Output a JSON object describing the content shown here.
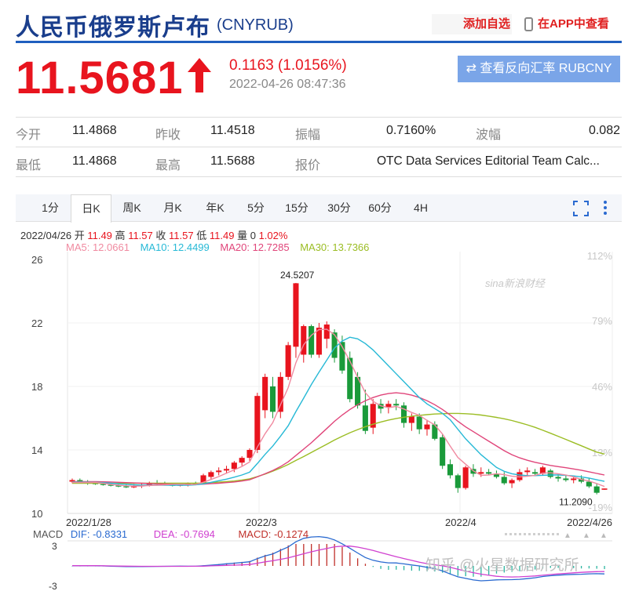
{
  "header": {
    "title": "人民币俄罗斯卢布",
    "code": "(CNYRUB)",
    "watchlist_label": "添加自选",
    "app_label": "在APP中查看",
    "app_icon": "phone-icon"
  },
  "quote": {
    "price": "11.5681",
    "change": "0.1163 (1.0156%)",
    "timestamp": "2022-04-26 08:47:36",
    "reverse_label": "查看反向汇率 RUBCNY",
    "reverse_icon": "swap-icon",
    "up_color": "#e8141e"
  },
  "stats": [
    {
      "label": "今开",
      "value": "11.4868"
    },
    {
      "label": "昨收",
      "value": "11.4518"
    },
    {
      "label": "振幅",
      "value": "0.7160%"
    },
    {
      "label": "波幅",
      "value": "0.082"
    },
    {
      "label": "最低",
      "value": "11.4868"
    },
    {
      "label": "最高",
      "value": "11.5688"
    },
    {
      "label": "报价",
      "value": "OTC Data Services Editorial Team Calc..."
    }
  ],
  "chart_tabs": [
    "1分",
    "日K",
    "周K",
    "月K",
    "年K",
    "5分",
    "15分",
    "30分",
    "60分",
    "4H"
  ],
  "active_tab": "日K",
  "ohlc_line": {
    "date": "2022/04/26",
    "open_label": "开",
    "open": "11.49",
    "high_label": "高",
    "high": "11.57",
    "close_label": "收",
    "close": "11.57",
    "low_label": "低",
    "low": "11.49",
    "vol_label": "量",
    "vol": "0",
    "pct": "1.02%"
  },
  "ma_line": {
    "ma5": "MA5: 12.0661",
    "ma10": "MA10: 12.4499",
    "ma20": "MA20: 12.7285",
    "ma30": "MA30: 13.7366"
  },
  "macd_line": {
    "label": "MACD",
    "dif": "DIF: -0.8331",
    "dea": "DEA: -0.7694",
    "macd": "MACD: -0.1274"
  },
  "watermarks": {
    "sina": "sina新浪财经",
    "zhihu": "知乎 @火星数据研究所"
  },
  "chart_data": {
    "type": "candlestick",
    "y_ticks": [
      "26",
      "22",
      "18",
      "14",
      "10"
    ],
    "pct_ticks": [
      "112%",
      "79%",
      "46%",
      "13%",
      "-19%"
    ],
    "x_ticks": [
      "2022/1/28",
      "2022/3",
      "2022/4",
      "2022/4/26"
    ],
    "high_mark": "24.5207",
    "low_mark": "11.2090",
    "ylim": [
      10,
      26
    ],
    "macd_ticks": [
      "3",
      "-3"
    ],
    "series_colors": {
      "ma5": "#f08aa0",
      "ma10": "#27b9d6",
      "ma20": "#e0457a",
      "ma30": "#9bbd24",
      "up": "#e8141e",
      "down": "#1a9a3a"
    },
    "candles": [
      {
        "o": 12.0,
        "h": 12.2,
        "l": 11.9,
        "c": 12.1
      },
      {
        "o": 12.1,
        "h": 12.2,
        "l": 11.9,
        "c": 11.95
      },
      {
        "o": 11.95,
        "h": 12.1,
        "l": 11.8,
        "c": 11.9
      },
      {
        "o": 11.9,
        "h": 12.0,
        "l": 11.8,
        "c": 11.85
      },
      {
        "o": 11.85,
        "h": 11.95,
        "l": 11.75,
        "c": 11.8
      },
      {
        "o": 11.8,
        "h": 11.9,
        "l": 11.7,
        "c": 11.75
      },
      {
        "o": 11.75,
        "h": 11.9,
        "l": 11.65,
        "c": 11.7
      },
      {
        "o": 11.7,
        "h": 11.85,
        "l": 11.6,
        "c": 11.65
      },
      {
        "o": 11.65,
        "h": 11.85,
        "l": 11.6,
        "c": 11.7
      },
      {
        "o": 11.7,
        "h": 11.9,
        "l": 11.6,
        "c": 11.8
      },
      {
        "o": 11.8,
        "h": 12.0,
        "l": 11.7,
        "c": 11.9
      },
      {
        "o": 11.9,
        "h": 12.1,
        "l": 11.8,
        "c": 11.85
      },
      {
        "o": 11.85,
        "h": 12.0,
        "l": 11.75,
        "c": 11.8
      },
      {
        "o": 11.8,
        "h": 11.9,
        "l": 11.7,
        "c": 11.75
      },
      {
        "o": 11.75,
        "h": 11.9,
        "l": 11.7,
        "c": 11.8
      },
      {
        "o": 11.8,
        "h": 11.95,
        "l": 11.7,
        "c": 11.9
      },
      {
        "o": 11.9,
        "h": 12.0,
        "l": 11.8,
        "c": 11.85
      },
      {
        "o": 11.9,
        "h": 12.5,
        "l": 11.85,
        "c": 12.4
      },
      {
        "o": 12.3,
        "h": 12.7,
        "l": 12.1,
        "c": 12.6
      },
      {
        "o": 12.6,
        "h": 12.9,
        "l": 12.4,
        "c": 12.7
      },
      {
        "o": 12.7,
        "h": 13.0,
        "l": 12.5,
        "c": 12.8
      },
      {
        "o": 12.8,
        "h": 13.3,
        "l": 12.6,
        "c": 13.2
      },
      {
        "o": 13.2,
        "h": 13.6,
        "l": 13.0,
        "c": 13.5
      },
      {
        "o": 13.5,
        "h": 14.1,
        "l": 13.3,
        "c": 14.0
      },
      {
        "o": 14.0,
        "h": 17.6,
        "l": 13.8,
        "c": 17.4
      },
      {
        "o": 16.5,
        "h": 18.8,
        "l": 16.0,
        "c": 18.6
      },
      {
        "o": 18.0,
        "h": 18.6,
        "l": 16.0,
        "c": 16.4
      },
      {
        "o": 16.4,
        "h": 18.9,
        "l": 16.0,
        "c": 18.6
      },
      {
        "o": 18.6,
        "h": 20.8,
        "l": 18.4,
        "c": 20.6
      },
      {
        "o": 20.5,
        "h": 24.52,
        "l": 19.8,
        "c": 24.5
      },
      {
        "o": 20.0,
        "h": 21.9,
        "l": 19.5,
        "c": 21.8
      },
      {
        "o": 21.8,
        "h": 21.9,
        "l": 19.8,
        "c": 20.0
      },
      {
        "o": 20.0,
        "h": 22.0,
        "l": 19.8,
        "c": 21.7
      },
      {
        "o": 21.0,
        "h": 22.1,
        "l": 20.4,
        "c": 21.9
      },
      {
        "o": 21.4,
        "h": 21.6,
        "l": 19.5,
        "c": 19.8
      },
      {
        "o": 20.8,
        "h": 21.2,
        "l": 18.8,
        "c": 19.0
      },
      {
        "o": 19.8,
        "h": 20.2,
        "l": 17.0,
        "c": 17.2
      },
      {
        "o": 18.6,
        "h": 18.9,
        "l": 16.6,
        "c": 16.8
      },
      {
        "o": 16.8,
        "h": 17.8,
        "l": 15.0,
        "c": 15.2
      },
      {
        "o": 15.4,
        "h": 17.2,
        "l": 15.0,
        "c": 16.9
      },
      {
        "o": 16.9,
        "h": 17.2,
        "l": 16.3,
        "c": 16.6
      },
      {
        "o": 16.7,
        "h": 17.1,
        "l": 16.3,
        "c": 16.9
      },
      {
        "o": 16.9,
        "h": 17.2,
        "l": 16.5,
        "c": 16.8
      },
      {
        "o": 16.8,
        "h": 17.0,
        "l": 15.4,
        "c": 15.7
      },
      {
        "o": 15.7,
        "h": 16.3,
        "l": 15.2,
        "c": 16.1
      },
      {
        "o": 16.1,
        "h": 16.3,
        "l": 15.0,
        "c": 15.3
      },
      {
        "o": 15.3,
        "h": 15.9,
        "l": 14.9,
        "c": 15.6
      },
      {
        "o": 15.6,
        "h": 15.8,
        "l": 14.6,
        "c": 14.7
      },
      {
        "o": 14.8,
        "h": 15.0,
        "l": 12.8,
        "c": 13.0
      },
      {
        "o": 13.1,
        "h": 13.4,
        "l": 12.2,
        "c": 12.4
      },
      {
        "o": 12.4,
        "h": 12.5,
        "l": 11.3,
        "c": 11.6
      },
      {
        "o": 11.6,
        "h": 13.0,
        "l": 11.5,
        "c": 12.9
      },
      {
        "o": 12.8,
        "h": 13.1,
        "l": 12.3,
        "c": 12.5
      },
      {
        "o": 12.5,
        "h": 12.9,
        "l": 12.3,
        "c": 12.6
      },
      {
        "o": 12.6,
        "h": 12.8,
        "l": 12.4,
        "c": 12.5
      },
      {
        "o": 12.5,
        "h": 12.7,
        "l": 12.2,
        "c": 12.3
      },
      {
        "o": 12.3,
        "h": 12.6,
        "l": 11.8,
        "c": 11.9
      },
      {
        "o": 11.9,
        "h": 12.2,
        "l": 11.6,
        "c": 12.1
      },
      {
        "o": 12.1,
        "h": 12.8,
        "l": 12.0,
        "c": 12.6
      },
      {
        "o": 12.6,
        "h": 12.9,
        "l": 12.4,
        "c": 12.7
      },
      {
        "o": 12.6,
        "h": 12.8,
        "l": 12.4,
        "c": 12.5
      },
      {
        "o": 12.5,
        "h": 13.0,
        "l": 12.4,
        "c": 12.9
      },
      {
        "o": 12.7,
        "h": 12.8,
        "l": 12.2,
        "c": 12.3
      },
      {
        "o": 12.3,
        "h": 12.5,
        "l": 12.0,
        "c": 12.2
      },
      {
        "o": 12.2,
        "h": 12.4,
        "l": 12.0,
        "c": 12.1
      },
      {
        "o": 12.1,
        "h": 12.3,
        "l": 11.9,
        "c": 12.2
      },
      {
        "o": 12.2,
        "h": 12.4,
        "l": 11.9,
        "c": 12.0
      },
      {
        "o": 12.0,
        "h": 12.2,
        "l": 11.6,
        "c": 11.7
      },
      {
        "o": 11.7,
        "h": 11.9,
        "l": 11.2,
        "c": 11.3
      },
      {
        "o": 11.49,
        "h": 11.57,
        "l": 11.49,
        "c": 11.57
      }
    ],
    "ma5": [
      11.95,
      11.95,
      11.95,
      11.95,
      11.9,
      11.82,
      11.78,
      11.74,
      11.72,
      11.73,
      11.76,
      11.78,
      11.8,
      11.83,
      11.84,
      11.82,
      11.82,
      11.96,
      12.14,
      12.32,
      12.54,
      12.74,
      12.96,
      13.24,
      14.18,
      15.02,
      15.72,
      16.84,
      17.92,
      19.5,
      20.62,
      21.22,
      21.58,
      21.6,
      21.26,
      20.5,
      19.6,
      18.58,
      17.6,
      17.06,
      16.78,
      16.66,
      16.74,
      16.58,
      16.36,
      16.18,
      15.86,
      15.58,
      15.0,
      14.24,
      13.52,
      13.1,
      12.68,
      12.4,
      12.42,
      12.5,
      12.44,
      12.34,
      12.3,
      12.34,
      12.4,
      12.54,
      12.56,
      12.5,
      12.42,
      12.3,
      12.14,
      12.04,
      11.88,
      11.7
    ],
    "ma10": [
      11.98,
      11.98,
      11.97,
      11.96,
      11.94,
      11.9,
      11.86,
      11.83,
      11.8,
      11.78,
      11.78,
      11.78,
      11.78,
      11.78,
      11.78,
      11.78,
      11.8,
      11.86,
      11.96,
      12.06,
      12.16,
      12.28,
      12.42,
      12.6,
      13.14,
      13.72,
      14.24,
      14.86,
      15.52,
      16.42,
      17.26,
      18.12,
      18.9,
      19.66,
      20.42,
      20.86,
      21.1,
      21.0,
      20.7,
      20.3,
      19.8,
      19.3,
      18.8,
      18.3,
      17.8,
      17.3,
      16.9,
      16.6,
      16.3,
      15.9,
      15.3,
      14.7,
      14.2,
      13.7,
      13.3,
      12.9,
      12.65,
      12.5,
      12.42,
      12.38,
      12.38,
      12.4,
      12.42,
      12.42,
      12.4,
      12.36,
      12.3,
      12.22,
      12.12,
      12.02
    ],
    "ma20": [
      12.0,
      12.0,
      12.0,
      12.0,
      11.99,
      11.98,
      11.96,
      11.94,
      11.92,
      11.9,
      11.88,
      11.86,
      11.85,
      11.84,
      11.83,
      11.82,
      11.82,
      11.84,
      11.87,
      11.9,
      11.94,
      11.98,
      12.04,
      12.12,
      12.3,
      12.5,
      12.7,
      12.95,
      13.25,
      13.65,
      14.05,
      14.45,
      14.9,
      15.35,
      15.8,
      16.2,
      16.55,
      16.85,
      17.1,
      17.3,
      17.45,
      17.55,
      17.6,
      17.55,
      17.45,
      17.3,
      17.1,
      16.85,
      16.55,
      16.2,
      15.8,
      15.45,
      15.15,
      14.85,
      14.55,
      14.25,
      13.95,
      13.7,
      13.5,
      13.35,
      13.22,
      13.12,
      13.02,
      12.95,
      12.88,
      12.8,
      12.72,
      12.62,
      12.52,
      12.42
    ],
    "ma30": [
      11.9,
      11.9,
      11.9,
      11.9,
      11.9,
      11.9,
      11.9,
      11.9,
      11.9,
      11.9,
      11.9,
      11.9,
      11.9,
      11.9,
      11.9,
      11.9,
      11.9,
      11.92,
      11.94,
      11.97,
      12.0,
      12.04,
      12.1,
      12.18,
      12.32,
      12.48,
      12.66,
      12.86,
      13.08,
      13.34,
      13.58,
      13.84,
      14.1,
      14.36,
      14.62,
      14.86,
      15.08,
      15.28,
      15.46,
      15.62,
      15.76,
      15.88,
      15.98,
      16.06,
      16.12,
      16.18,
      16.22,
      16.26,
      16.28,
      16.3,
      16.3,
      16.28,
      16.25,
      16.2,
      16.13,
      16.05,
      15.96,
      15.85,
      15.72,
      15.58,
      15.42,
      15.24,
      15.05,
      14.86,
      14.66,
      14.46,
      14.26,
      14.06,
      13.86,
      13.74
    ]
  }
}
